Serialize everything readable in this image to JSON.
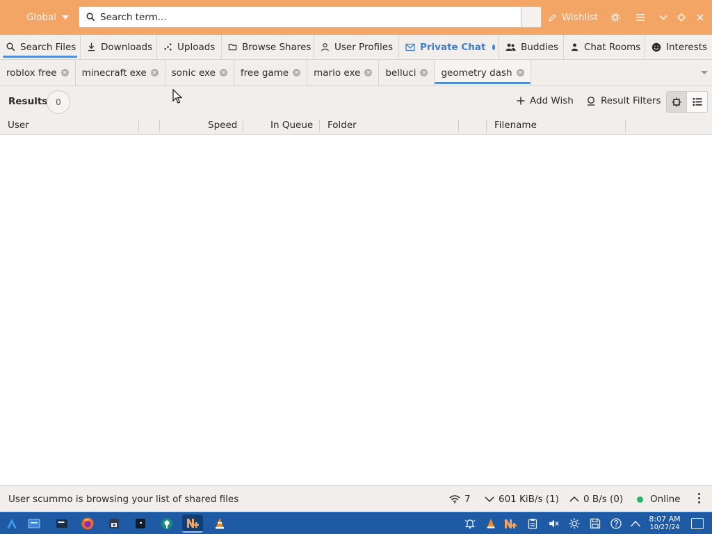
{
  "header": {
    "scope_label": "Global",
    "search_placeholder": "Search term...",
    "search_value": "",
    "wishlist_label": "Wishlist"
  },
  "main_tabs": [
    {
      "label": "Search Files",
      "icon": "search-icon"
    },
    {
      "label": "Downloads",
      "icon": "download-icon"
    },
    {
      "label": "Uploads",
      "icon": "upload-icon"
    },
    {
      "label": "Browse Shares",
      "icon": "folder-icon"
    },
    {
      "label": "User Profiles",
      "icon": "user-icon"
    },
    {
      "label": "Private Chat",
      "icon": "mail-icon"
    },
    {
      "label": "Buddies",
      "icon": "buddies-icon"
    },
    {
      "label": "Chat Rooms",
      "icon": "chat-rooms-icon"
    },
    {
      "label": "Interests",
      "icon": "smiley-icon"
    }
  ],
  "search_tabs": [
    {
      "label": "roblox free"
    },
    {
      "label": "minecraft exe"
    },
    {
      "label": "sonic exe"
    },
    {
      "label": "free game"
    },
    {
      "label": "mario exe"
    },
    {
      "label": "belluci"
    },
    {
      "label": "geometry dash"
    }
  ],
  "results_toolbar": {
    "results_label": "Results",
    "results_count": "0",
    "add_wish_label": "Add Wish",
    "result_filters_label": "Result Filters"
  },
  "columns": {
    "user": "User",
    "speed": "Speed",
    "in_queue": "In Queue",
    "folder": "Folder",
    "filename": "Filename"
  },
  "status": {
    "message": "User scummo is browsing your list of shared files",
    "connections": "7",
    "download_speed": "601 KiB/s (1)",
    "upload_speed": "0 B/s (0)",
    "online_label": "Online"
  },
  "taskbar": {
    "time": "8:07 AM",
    "date": "10/27/24"
  },
  "colors": {
    "header_bg": "#f3a566",
    "accent_blue": "#4f8fd6",
    "private_chat_highlight": "#3f7fd0",
    "online_green": "#2fb36b",
    "taskbar_bg": "#1f5aa5"
  }
}
